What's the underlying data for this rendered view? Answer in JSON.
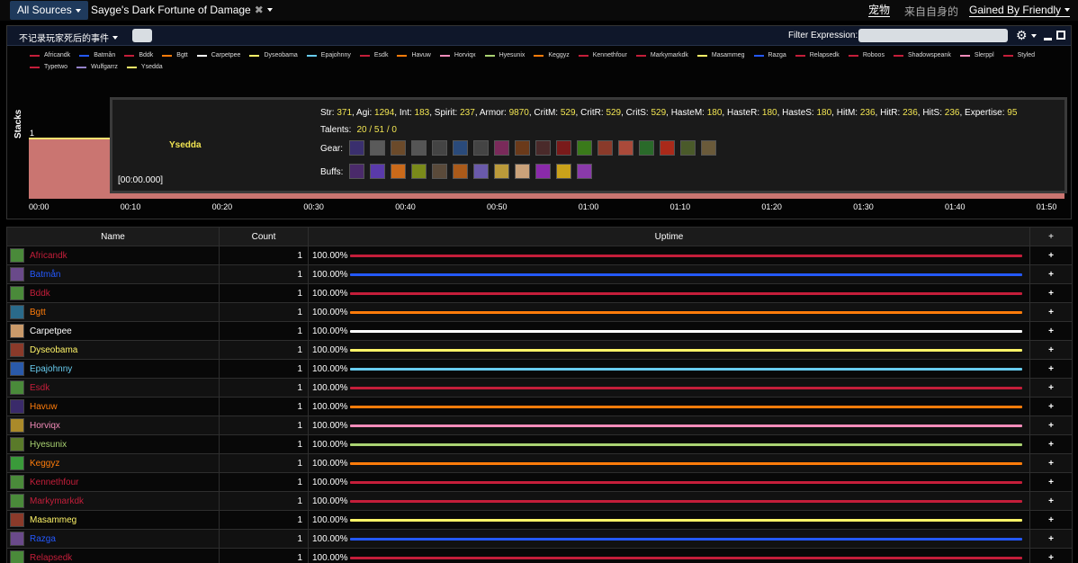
{
  "topbar": {
    "sources_label": "All Sources",
    "aura_title": "Sayge's Dark Fortune of Damage",
    "pet_label": "宠物",
    "from_self_label": "来自自身的",
    "gained_by_label": "Gained By Friendly"
  },
  "graph": {
    "death_filter_label": "不记录玩家死后的事件",
    "filter_label": "Filter Expression:",
    "y_axis_label": "Stacks",
    "y_ticks": [
      "1",
      "0"
    ],
    "x_ticks": [
      "00:00",
      "00:10",
      "00:20",
      "00:30",
      "00:40",
      "00:50",
      "01:00",
      "01:10",
      "01:20",
      "01:30",
      "01:40",
      "01:50"
    ],
    "legend": [
      {
        "name": "Africandk",
        "color": "#c41e3a"
      },
      {
        "name": "Batmån",
        "color": "#2459ff"
      },
      {
        "name": "Bddk",
        "color": "#c41e3a"
      },
      {
        "name": "Bgtt",
        "color": "#ff7c0a"
      },
      {
        "name": "Carpetpee",
        "color": "#ffffff"
      },
      {
        "name": "Dyseobama",
        "color": "#fff468"
      },
      {
        "name": "Epajohnny",
        "color": "#68ccef"
      },
      {
        "name": "Esdk",
        "color": "#c41e3a"
      },
      {
        "name": "Havuw",
        "color": "#ff7c0a"
      },
      {
        "name": "Horviqx",
        "color": "#f48cba"
      },
      {
        "name": "Hyesunix",
        "color": "#aad372"
      },
      {
        "name": "Keggyz",
        "color": "#ff7c0a"
      },
      {
        "name": "Kennethfour",
        "color": "#c41e3a"
      },
      {
        "name": "Markymarkdk",
        "color": "#c41e3a"
      },
      {
        "name": "Masammeg",
        "color": "#fff468"
      },
      {
        "name": "Razga",
        "color": "#2459ff"
      },
      {
        "name": "Relapsedk",
        "color": "#c41e3a"
      },
      {
        "name": "Roboos",
        "color": "#c41e3a"
      },
      {
        "name": "Shadowspeank",
        "color": "#c41e3a"
      },
      {
        "name": "Slerppl",
        "color": "#f48cba"
      },
      {
        "name": "Styled",
        "color": "#c41e3a"
      },
      {
        "name": "Typetwo",
        "color": "#c41e3a"
      },
      {
        "name": "Wulfgarrz",
        "color": "#9482c9"
      },
      {
        "name": "Ysedda",
        "color": "#fff468"
      }
    ]
  },
  "tooltip": {
    "name": "Ysedda",
    "time": "[00:00.000]",
    "stats": [
      {
        "k": "Str: ",
        "v": "371"
      },
      {
        "k": ", Agi: ",
        "v": "1294"
      },
      {
        "k": ", Int: ",
        "v": "183"
      },
      {
        "k": ", Spirit: ",
        "v": "237"
      },
      {
        "k": ", Armor: ",
        "v": "9870"
      },
      {
        "k": ", CritM: ",
        "v": "529"
      },
      {
        "k": ", CritR: ",
        "v": "529"
      },
      {
        "k": ", CritS: ",
        "v": "529"
      },
      {
        "k": ", HasteM: ",
        "v": "180"
      },
      {
        "k": ", HasteR: ",
        "v": "180"
      },
      {
        "k": ", HasteS: ",
        "v": "180"
      },
      {
        "k": ", HitM: ",
        "v": "236"
      },
      {
        "k": ", HitR: ",
        "v": "236"
      },
      {
        "k": ", HitS: ",
        "v": "236"
      },
      {
        "k": ", Expertise: ",
        "v": "95"
      }
    ],
    "talents_label": "Talents:",
    "talents_value": "20 / 51 / 0",
    "gear_label": "Gear:",
    "buffs_label": "Buffs:",
    "gear_colors": [
      "#3a2f6e",
      "#5a5a5a",
      "#6b4a2a",
      "#555",
      "#444",
      "#2a4a7a",
      "#444",
      "#7a2a5a",
      "#6b3a1a",
      "#4a2a2a",
      "#7a1a1a",
      "#3a7a1a",
      "#8a3a2a",
      "#aa4a3a",
      "#2a6a2a",
      "#aa2a1a",
      "#4a5a2a",
      "#6a5a3a"
    ],
    "buff_colors": [
      "#4a2a6a",
      "#5a3aaa",
      "#ca6a1a",
      "#7a8a1a",
      "#5a4a3a",
      "#aa5a1a",
      "#6a5aaa",
      "#bb9a3a",
      "#caa27a",
      "#8a2aaa",
      "#caa21a",
      "#8a3aaa"
    ]
  },
  "table": {
    "headers": {
      "name": "Name",
      "count": "Count",
      "uptime": "Uptime",
      "plus": "+"
    },
    "rows": [
      {
        "name": "Africandk",
        "count": "1",
        "uptime": "100.00%",
        "color": "#c41e3a",
        "uptime_fraction": 1.0,
        "icon": "#4a8a3a"
      },
      {
        "name": "Batmån",
        "count": "1",
        "uptime": "100.00%",
        "color": "#2459ff",
        "uptime_fraction": 1.0,
        "icon": "#6a4a8a"
      },
      {
        "name": "Bddk",
        "count": "1",
        "uptime": "100.00%",
        "color": "#c41e3a",
        "uptime_fraction": 1.0,
        "icon": "#4a8a3a"
      },
      {
        "name": "Bgtt",
        "count": "1",
        "uptime": "100.00%",
        "color": "#ff7c0a",
        "uptime_fraction": 1.0,
        "icon": "#2a6a8a"
      },
      {
        "name": "Carpetpee",
        "count": "1",
        "uptime": "100.00%",
        "color": "#ffffff",
        "uptime_fraction": 1.0,
        "icon": "#ca9a6a"
      },
      {
        "name": "Dyseobama",
        "count": "1",
        "uptime": "100.00%",
        "color": "#fff468",
        "uptime_fraction": 1.0,
        "icon": "#8a3a2a"
      },
      {
        "name": "Epajohnny",
        "count": "1",
        "uptime": "100.00%",
        "color": "#68ccef",
        "uptime_fraction": 1.0,
        "icon": "#2a5aaa"
      },
      {
        "name": "Esdk",
        "count": "1",
        "uptime": "100.00%",
        "color": "#c41e3a",
        "uptime_fraction": 1.0,
        "icon": "#4a8a3a"
      },
      {
        "name": "Havuw",
        "count": "1",
        "uptime": "100.00%",
        "color": "#ff7c0a",
        "uptime_fraction": 1.0,
        "icon": "#3a2a6a"
      },
      {
        "name": "Horviqx",
        "count": "1",
        "uptime": "100.00%",
        "color": "#f48cba",
        "uptime_fraction": 1.0,
        "icon": "#aa8a2a"
      },
      {
        "name": "Hyesunix",
        "count": "1",
        "uptime": "100.00%",
        "color": "#aad372",
        "uptime_fraction": 1.0,
        "icon": "#5a7a2a"
      },
      {
        "name": "Keggyz",
        "count": "1",
        "uptime": "100.00%",
        "color": "#ff7c0a",
        "uptime_fraction": 1.0,
        "icon": "#3a9a3a"
      },
      {
        "name": "Kennethfour",
        "count": "1",
        "uptime": "100.00%",
        "color": "#c41e3a",
        "uptime_fraction": 1.0,
        "icon": "#4a8a3a"
      },
      {
        "name": "Markymarkdk",
        "count": "1",
        "uptime": "100.00%",
        "color": "#c41e3a",
        "uptime_fraction": 1.0,
        "icon": "#4a8a3a"
      },
      {
        "name": "Masammeg",
        "count": "1",
        "uptime": "100.00%",
        "color": "#fff468",
        "uptime_fraction": 1.0,
        "icon": "#8a3a2a"
      },
      {
        "name": "Razga",
        "count": "1",
        "uptime": "100.00%",
        "color": "#2459ff",
        "uptime_fraction": 1.0,
        "icon": "#6a4a8a"
      },
      {
        "name": "Relapsedk",
        "count": "1",
        "uptime": "100.00%",
        "color": "#c41e3a",
        "uptime_fraction": 1.0,
        "icon": "#4a8a3a"
      }
    ]
  }
}
